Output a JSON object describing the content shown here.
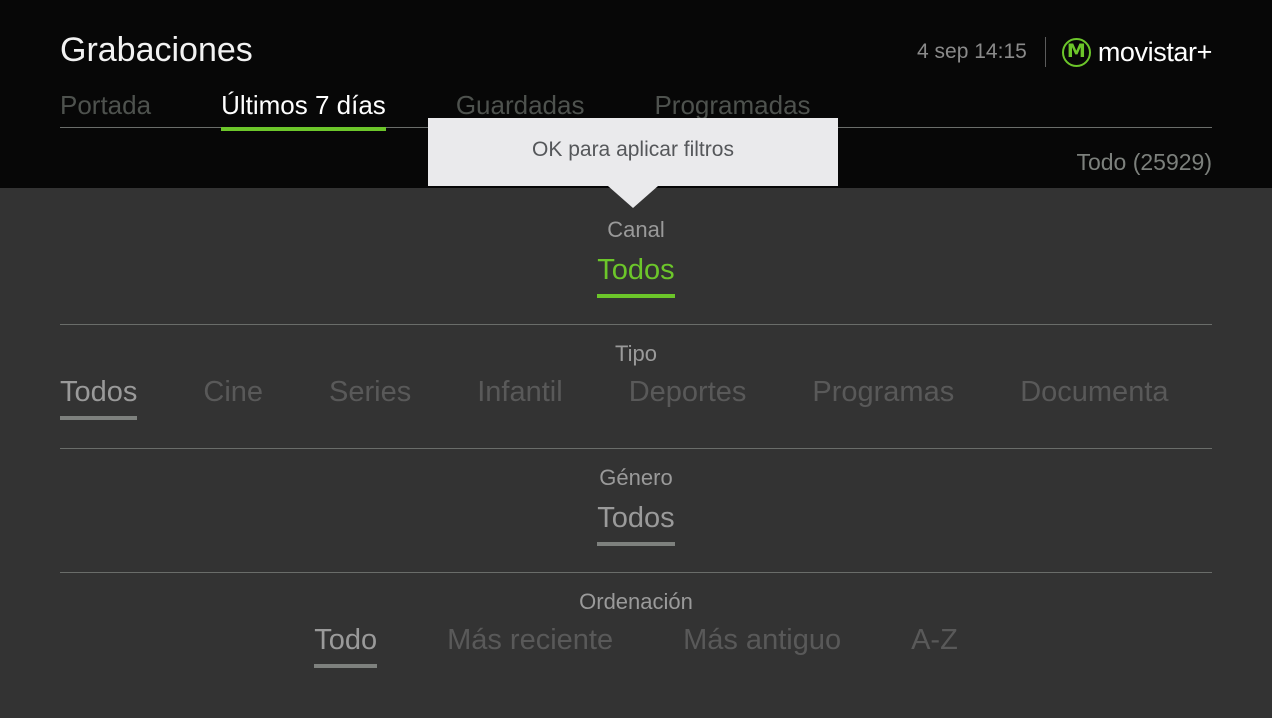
{
  "header": {
    "title": "Grabaciones",
    "clock": "4 sep 14:15",
    "brand_mark_glyph": "M",
    "brand_name": "movistar+",
    "accent_color": "#6cc62a",
    "panel_color": "#333333",
    "header_color": "#070707"
  },
  "tabs": [
    {
      "label": "Portada",
      "active": false
    },
    {
      "label": "Últimos 7 días",
      "active": true
    },
    {
      "label": "Guardadas",
      "active": false
    },
    {
      "label": "Programadas",
      "active": false
    }
  ],
  "count_label": "Todo (25929)",
  "tooltip": {
    "text": "OK para aplicar filtros"
  },
  "filters": [
    {
      "label": "Canal",
      "options": [
        {
          "label": "Todos",
          "state": "selected-green"
        }
      ]
    },
    {
      "label": "Tipo",
      "options": [
        {
          "label": "Todos",
          "state": "selected-gray"
        },
        {
          "label": "Cine",
          "state": "normal"
        },
        {
          "label": "Series",
          "state": "normal"
        },
        {
          "label": "Infantil",
          "state": "normal"
        },
        {
          "label": "Deportes",
          "state": "normal"
        },
        {
          "label": "Programas",
          "state": "normal"
        },
        {
          "label": "Documenta",
          "state": "normal"
        }
      ]
    },
    {
      "label": "Género",
      "options": [
        {
          "label": "Todos",
          "state": "selected-gray"
        }
      ]
    },
    {
      "label": "Ordenación",
      "options": [
        {
          "label": "Todo",
          "state": "selected-gray"
        },
        {
          "label": "Más reciente",
          "state": "normal"
        },
        {
          "label": "Más antiguo",
          "state": "normal"
        },
        {
          "label": "A-Z",
          "state": "normal"
        }
      ]
    }
  ]
}
